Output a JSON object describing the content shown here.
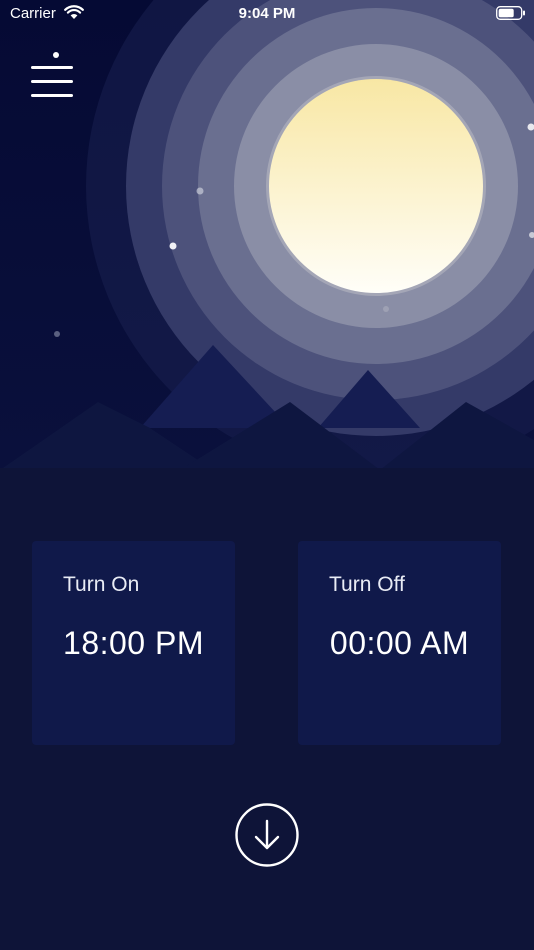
{
  "status_bar": {
    "carrier": "Carrier",
    "time": "9:04 PM",
    "wifi_icon": "wifi-icon",
    "battery_icon": "battery-icon"
  },
  "menu": {
    "icon": "hamburger-menu-icon"
  },
  "scene": {
    "moon_icon": "moon-icon",
    "mountains_icon": "mountains-icon"
  },
  "schedule": {
    "turn_on": {
      "label": "Turn On",
      "time": "18:00 PM"
    },
    "turn_off": {
      "label": "Turn Off",
      "time": "00:00 AM"
    }
  },
  "action": {
    "icon": "arrow-down-circle-icon"
  },
  "colors": {
    "background": "#0e1438",
    "card": "#10194a",
    "moon": "#fbeeb6",
    "sky": "#070c3a"
  }
}
